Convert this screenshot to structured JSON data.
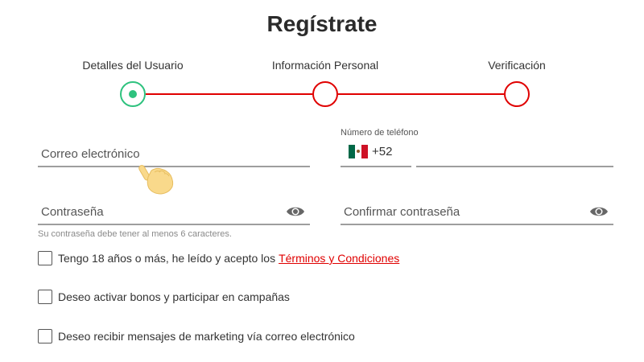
{
  "header": {
    "title": "Regístrate"
  },
  "stepper": {
    "steps": [
      {
        "label": "Detalles del Usuario",
        "state": "active"
      },
      {
        "label": "Información Personal",
        "state": "pending"
      },
      {
        "label": "Verificación",
        "state": "pending"
      }
    ],
    "active_color": "#2ec27e",
    "pending_color": "#e00000"
  },
  "form": {
    "email": {
      "placeholder": "Correo electrónico",
      "value": ""
    },
    "phone": {
      "label": "Número de teléfono",
      "country_flag": "mexico-flag-icon",
      "dial_code": "+52",
      "value": ""
    },
    "password": {
      "placeholder": "Contraseña",
      "value": "",
      "toggle_icon": "eye-icon"
    },
    "confirm_password": {
      "placeholder": "Confirmar contraseña",
      "value": "",
      "toggle_icon": "eye-icon"
    },
    "password_hint": "Su contraseña debe tener al menos 6 caracteres."
  },
  "checkboxes": [
    {
      "label": "Tengo 18 años o más, he leído y acepto los",
      "link": "Términos y Condiciones",
      "checked": false
    },
    {
      "label": "Deseo activar bonos y participar en campañas",
      "checked": false
    },
    {
      "label": "Deseo recibir mensajes de marketing vía correo electrónico",
      "checked": false
    }
  ],
  "cursor": {
    "icon": "hand-pointer-icon"
  },
  "colors": {
    "accent_red": "#e00000",
    "accent_green": "#2ec27e",
    "underline": "#9e9e9e"
  }
}
